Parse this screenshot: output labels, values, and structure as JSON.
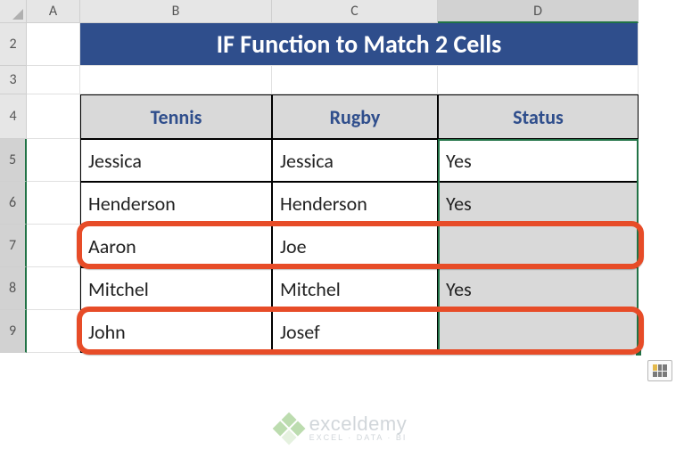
{
  "columns": {
    "corner": "",
    "A": "A",
    "B": "B",
    "C": "C",
    "D": "D"
  },
  "rows": {
    "2": "2",
    "3": "3",
    "4": "4",
    "5": "5",
    "6": "6",
    "7": "7",
    "8": "8",
    "9": "9"
  },
  "title": "IF Function to Match 2 Cells",
  "headers": {
    "tennis": "Tennis",
    "rugby": "Rugby",
    "status": "Status"
  },
  "data": [
    {
      "tennis": "Jessica",
      "rugby": "Jessica",
      "status": "Yes"
    },
    {
      "tennis": "Henderson",
      "rugby": "Henderson",
      "status": "Yes"
    },
    {
      "tennis": "Aaron",
      "rugby": "Joe",
      "status": ""
    },
    {
      "tennis": "Mitchel",
      "rugby": "Mitchel",
      "status": "Yes"
    },
    {
      "tennis": "John",
      "rugby": "Josef",
      "status": ""
    }
  ],
  "watermark": {
    "name": "exceldemy",
    "tagline": "EXCEL · DATA · BI"
  },
  "chart_data": {
    "type": "table",
    "title": "IF Function to Match 2 Cells",
    "columns": [
      "Tennis",
      "Rugby",
      "Status"
    ],
    "rows": [
      [
        "Jessica",
        "Jessica",
        "Yes"
      ],
      [
        "Henderson",
        "Henderson",
        "Yes"
      ],
      [
        "Aaron",
        "Joe",
        ""
      ],
      [
        "Mitchel",
        "Mitchel",
        "Yes"
      ],
      [
        "John",
        "Josef",
        ""
      ]
    ]
  }
}
